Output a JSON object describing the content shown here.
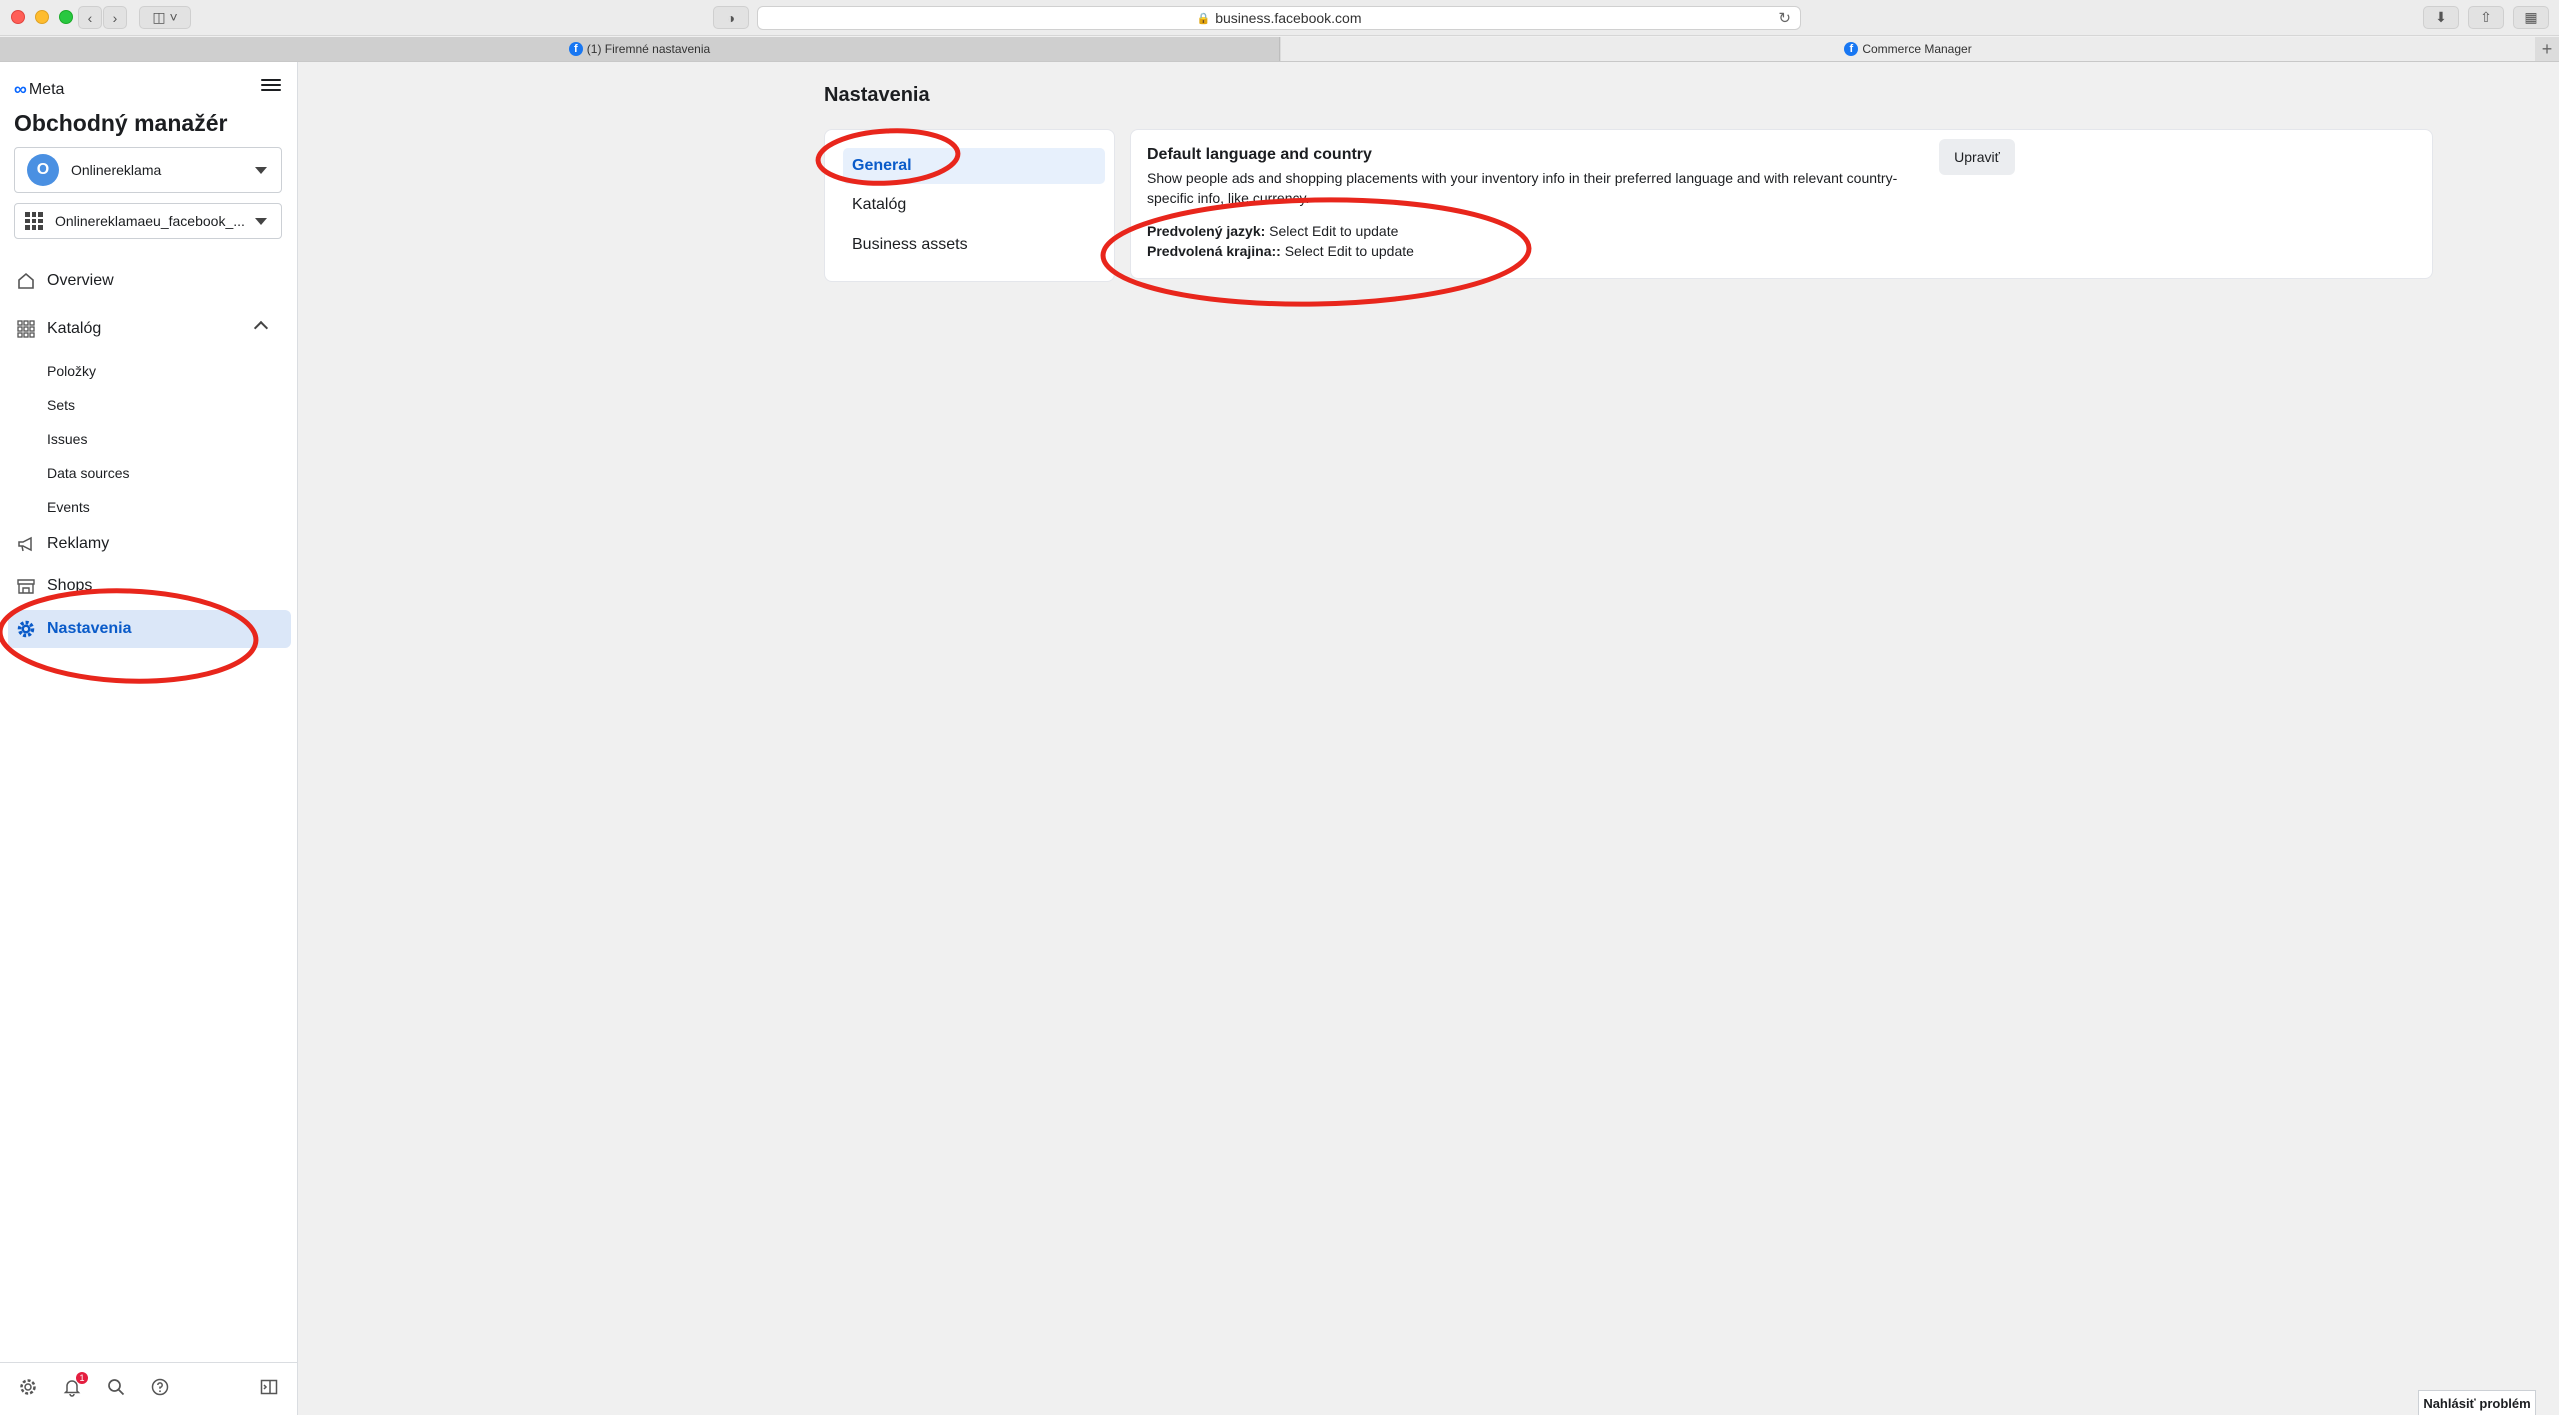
{
  "browser": {
    "url": "business.facebook.com",
    "tabs": [
      {
        "label": "(1) Firemné nastavenia"
      },
      {
        "label": "Commerce Manager"
      }
    ]
  },
  "sidebar": {
    "logo_text": "Meta",
    "title": "Obchodný manažér",
    "account": {
      "initial": "O",
      "name": "Onlinereklama"
    },
    "catalog_select": "Onlinereklamaeu_facebook_...",
    "nav": {
      "overview": "Overview",
      "catalog": "Katalóg",
      "catalog_items": [
        "Položky",
        "Sets",
        "Issues",
        "Data sources",
        "Events"
      ],
      "ads": "Reklamy",
      "shops": "Shops",
      "settings": "Nastavenia"
    },
    "notification_count": "1"
  },
  "main": {
    "page_title": "Nastavenia",
    "settings_nav": [
      "General",
      "Katalóg",
      "Business assets"
    ],
    "card": {
      "title": "Default language and country",
      "description": "Show people ads and shopping placements with your inventory info in their preferred language and with relevant country-specific info, like currency.",
      "edit_label": "Upraviť",
      "language_label": "Predvolený jazyk:",
      "language_value": "Select Edit to update",
      "country_label": "Predvolená krajina::",
      "country_value": "Select Edit to update"
    },
    "report_label": "Nahlásiť problém"
  },
  "colors": {
    "accent": "#0a5bc9",
    "annotation": "#e8261c",
    "active_bg": "#dbe7f8"
  }
}
